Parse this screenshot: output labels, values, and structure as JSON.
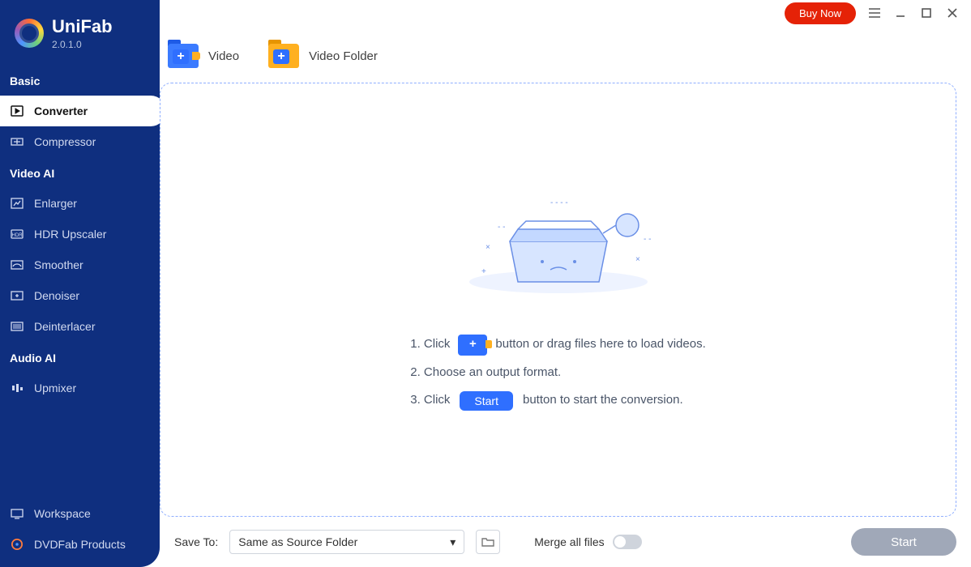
{
  "app": {
    "name": "UniFab",
    "version": "2.0.1.0"
  },
  "titlebar": {
    "buy": "Buy Now"
  },
  "sidebar": {
    "sections": [
      {
        "label": "Basic",
        "items": [
          {
            "id": "converter",
            "label": "Converter",
            "active": true
          },
          {
            "id": "compressor",
            "label": "Compressor"
          }
        ]
      },
      {
        "label": "Video AI",
        "items": [
          {
            "id": "enlarger",
            "label": "Enlarger"
          },
          {
            "id": "hdr",
            "label": "HDR Upscaler"
          },
          {
            "id": "smoother",
            "label": "Smoother"
          },
          {
            "id": "denoiser",
            "label": "Denoiser"
          },
          {
            "id": "deinterlacer",
            "label": "Deinterlacer"
          }
        ]
      },
      {
        "label": "Audio AI",
        "items": [
          {
            "id": "upmixer",
            "label": "Upmixer"
          }
        ]
      }
    ],
    "footer": [
      {
        "id": "workspace",
        "label": "Workspace"
      },
      {
        "id": "dvdfab",
        "label": "DVDFab Products"
      }
    ]
  },
  "toolbar": {
    "add_video": "Video",
    "add_folder": "Video Folder"
  },
  "steps": {
    "s1a": "1. Click",
    "s1b": "button or drag files here to load videos.",
    "s2": "2. Choose an output format.",
    "s3a": "3. Click",
    "s3_btn": "Start",
    "s3b": "button to start the conversion."
  },
  "bottom": {
    "saveto_label": "Save To:",
    "saveto_value": "Same as Source Folder",
    "merge_label": "Merge all files",
    "start": "Start"
  }
}
